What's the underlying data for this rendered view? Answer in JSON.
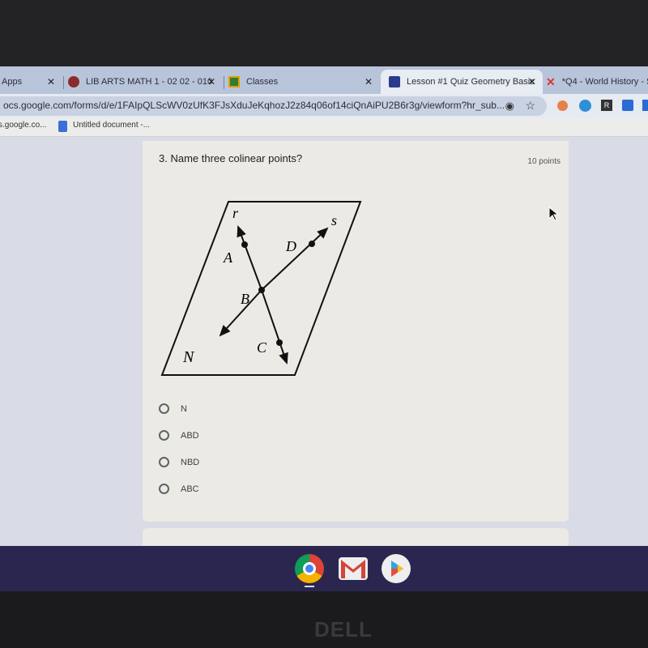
{
  "browser": {
    "tabs": [
      {
        "label": "Apps",
        "icon": "apps-icon",
        "active": false
      },
      {
        "label": "LIB ARTS MATH 1 - 02 02 - 010",
        "icon": "course-icon",
        "active": false
      },
      {
        "label": "Classes",
        "icon": "classroom-icon",
        "active": false
      },
      {
        "label": "Lesson #1 Quiz Geometry Basic",
        "icon": "forms-icon",
        "active": true
      },
      {
        "label": "*Q4 - World History - S",
        "icon": "x-logo-icon",
        "active": false
      }
    ],
    "url": "ocs.google.com/forms/d/e/1FAIpQLScWV0zUfK3FJsXduJeKqhozJ2z84q06of14ciQnAiPU2B6r3g/viewform?hr_sub...",
    "bookmarks": [
      {
        "label": "s.google.co..."
      },
      {
        "label": "Untitled document -..."
      }
    ]
  },
  "question": {
    "title": "3. Name three colinear points?",
    "points": "10 points",
    "figure": {
      "plane_label": "N",
      "line_labels": [
        "r",
        "s"
      ],
      "point_labels": [
        "A",
        "B",
        "C",
        "D"
      ]
    },
    "options": [
      {
        "label": "N",
        "selected": false
      },
      {
        "label": "ABD",
        "selected": false
      },
      {
        "label": "NBD",
        "selected": false
      },
      {
        "label": "ABC",
        "selected": false
      }
    ]
  },
  "shelf": {
    "apps": [
      "chrome-icon",
      "gmail-icon",
      "play-store-icon"
    ]
  },
  "device": {
    "brand": "DELL"
  }
}
